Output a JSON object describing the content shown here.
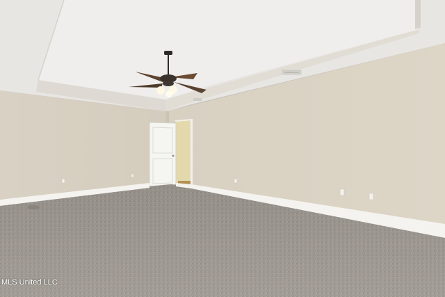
{
  "watermark": "MLS United LLC"
}
